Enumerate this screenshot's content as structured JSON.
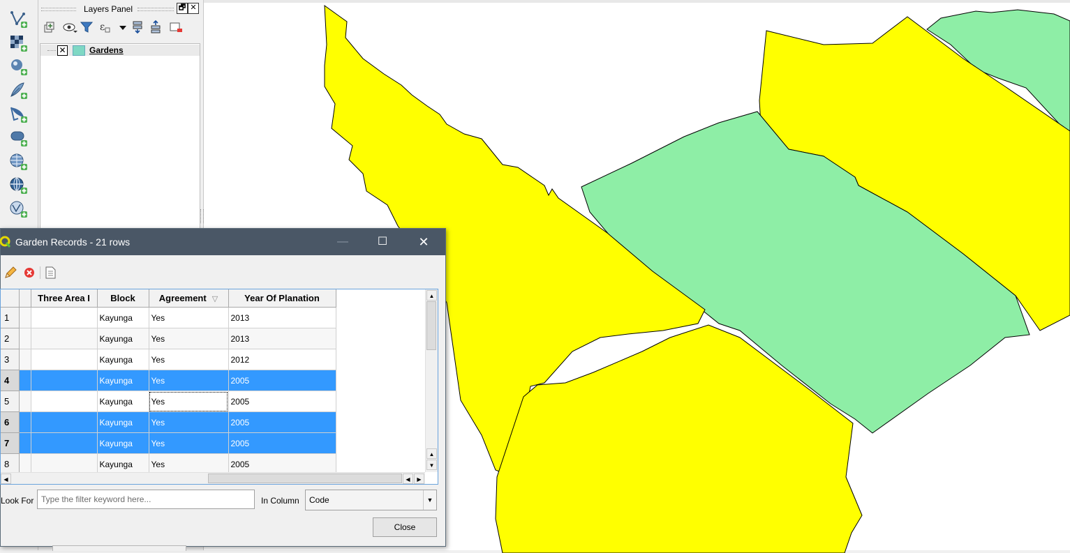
{
  "layers_panel": {
    "title": "Layers Panel",
    "float_glyph": "🗗",
    "close_glyph": "✕",
    "layer": {
      "name": "Gardens",
      "visible_glyph": "✕",
      "swatch_color": "#7fd8c4"
    }
  },
  "left_toolbar": {
    "icons": [
      "add-vector-layer-icon",
      "add-raster-layer-icon",
      "add-postgis-layer-icon",
      "add-spatialite-layer-icon",
      "add-mssql-layer-icon",
      "add-oracle-layer-icon",
      "add-wms-layer-icon",
      "add-wcs-layer-icon",
      "add-wfs-layer-icon"
    ]
  },
  "map": {
    "colors": {
      "yellow": "#ffff00",
      "green": "#8eeea6",
      "outline": "#000000"
    }
  },
  "dialog": {
    "title": "Garden Records - 21 rows",
    "minimize_glyph": "—",
    "maximize_glyph": "☐",
    "close_glyph": "✕",
    "toolbar": [
      "toggle-editing-icon",
      "delete-selected-icon",
      "open-field-calculator-icon"
    ],
    "table": {
      "columns": [
        "Three Area I",
        "Block",
        "Agreement",
        "Year Of Planation"
      ],
      "sort_glyph": "▽",
      "rows": [
        {
          "num": "1",
          "area": "",
          "block": "Kayunga",
          "agreement": "Yes",
          "year": "2013",
          "selected": false
        },
        {
          "num": "2",
          "area": "",
          "block": "Kayunga",
          "agreement": "Yes",
          "year": "2013",
          "selected": false
        },
        {
          "num": "3",
          "area": "",
          "block": "Kayunga",
          "agreement": "Yes",
          "year": "2012",
          "selected": false
        },
        {
          "num": "4",
          "area": "",
          "block": "Kayunga",
          "agreement": "Yes",
          "year": "2005",
          "selected": true
        },
        {
          "num": "5",
          "area": "",
          "block": "Kayunga",
          "agreement": "Yes",
          "year": "2005",
          "selected": false
        },
        {
          "num": "6",
          "area": "",
          "block": "Kayunga",
          "agreement": "Yes",
          "year": "2005",
          "selected": true
        },
        {
          "num": "7",
          "area": "",
          "block": "Kayunga",
          "agreement": "Yes",
          "year": "2005",
          "selected": true
        },
        {
          "num": "8",
          "area": "",
          "block": "Kayunga",
          "agreement": "Yes",
          "year": "2005",
          "selected": false
        }
      ],
      "scroll_up_glyph": "▲",
      "scroll_down_glyph": "▼",
      "scroll_left_glyph": "◀",
      "scroll_right_glyph": "▶",
      "selection_color": "#3399ff"
    },
    "filter": {
      "look_for_label": "Look For",
      "placeholder": "Type the filter keyword here...",
      "value": "",
      "in_column_label": "In Column",
      "column_value": "Code",
      "dropdown_glyph": "▼"
    },
    "close_button": "Close"
  }
}
